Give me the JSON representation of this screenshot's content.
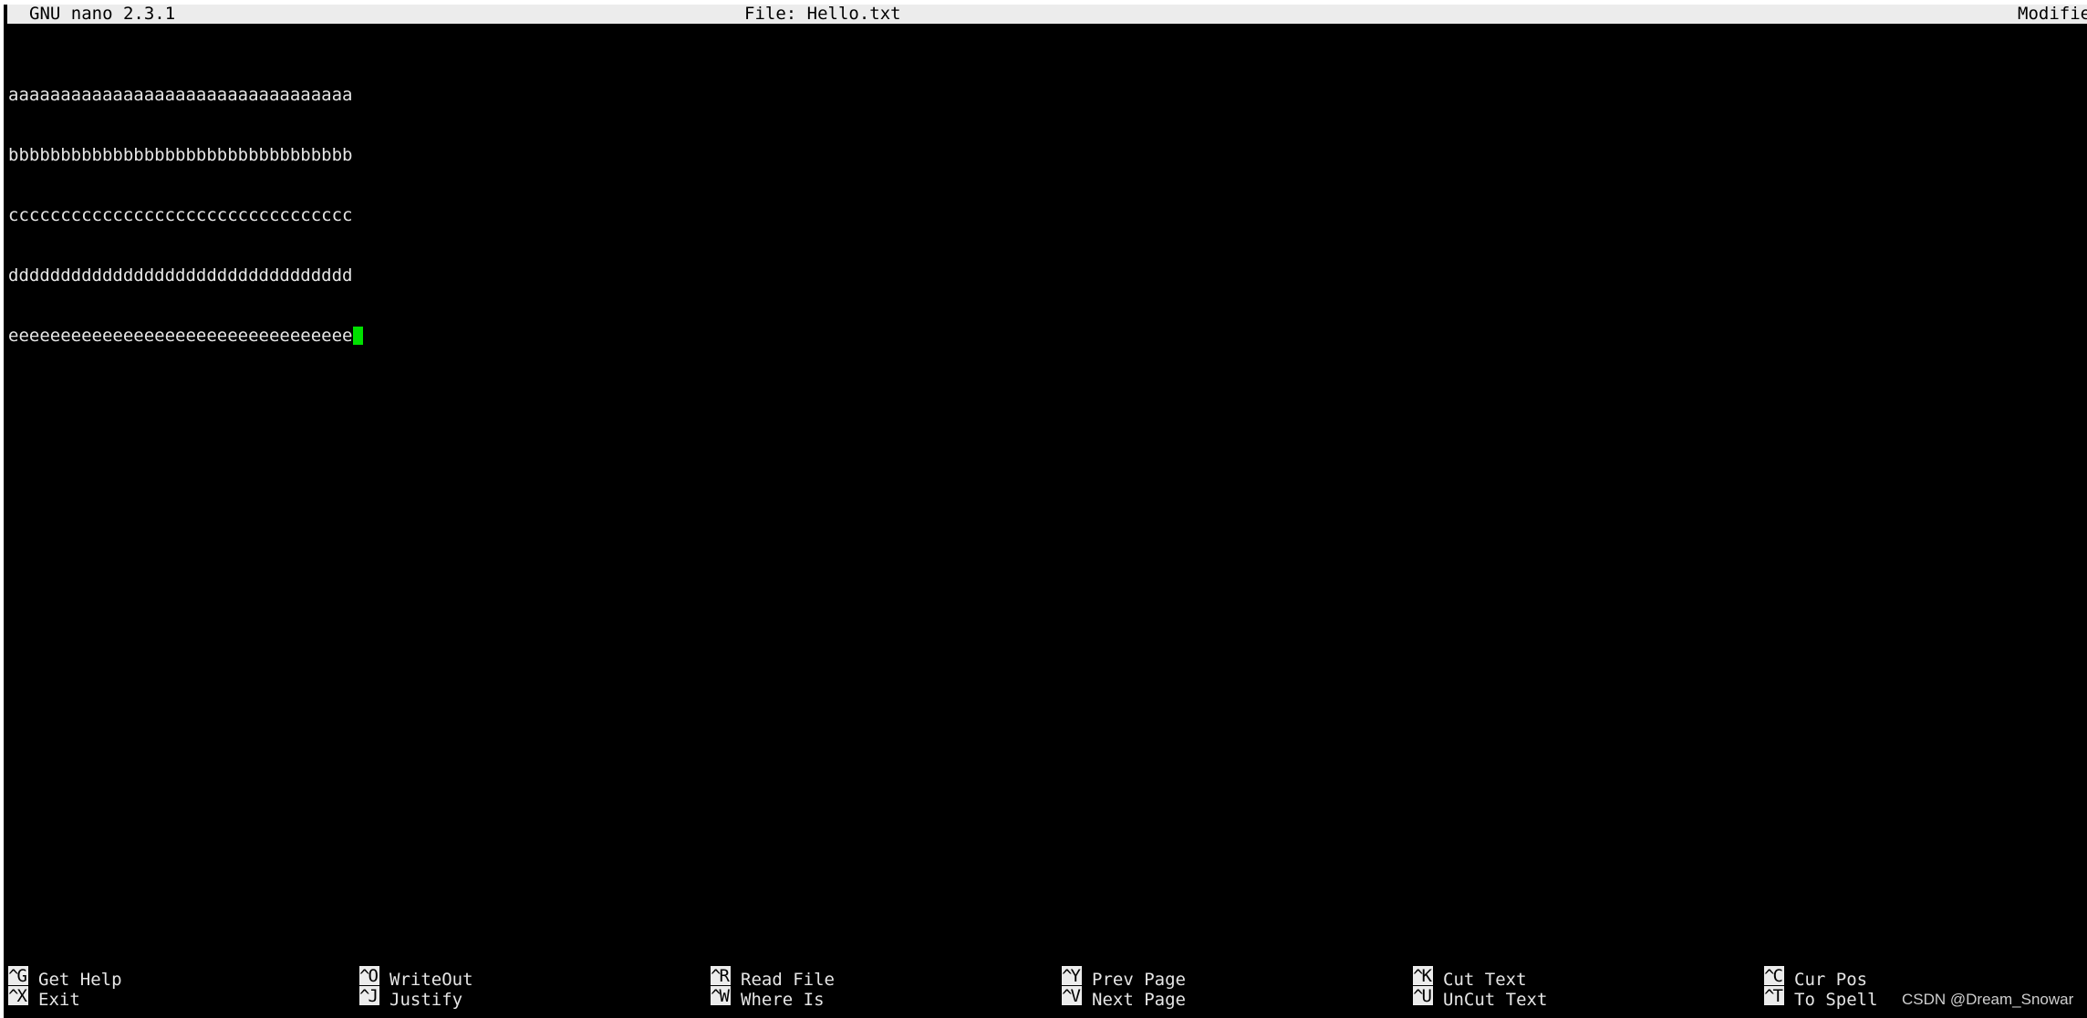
{
  "header": {
    "app_version": "GNU nano 2.3.1",
    "file_label": "File: Hello.txt",
    "status": "Modified"
  },
  "buffer": {
    "lines": [
      "aaaaaaaaaaaaaaaaaaaaaaaaaaaaaaaaa",
      "bbbbbbbbbbbbbbbbbbbbbbbbbbbbbbbbb",
      "ccccccccccccccccccccccccccccccccc",
      "ddddddddddddddddddddddddddddddddd",
      "eeeeeeeeeeeeeeeeeeeeeeeeeeeeeeeee"
    ]
  },
  "cursor_color": "#00e000",
  "shortcuts": [
    {
      "key": "^G",
      "label": "Get Help"
    },
    {
      "key": "^O",
      "label": "WriteOut"
    },
    {
      "key": "^R",
      "label": "Read File"
    },
    {
      "key": "^Y",
      "label": "Prev Page"
    },
    {
      "key": "^K",
      "label": "Cut Text"
    },
    {
      "key": "^C",
      "label": "Cur Pos"
    },
    {
      "key": "^X",
      "label": "Exit"
    },
    {
      "key": "^J",
      "label": "Justify"
    },
    {
      "key": "^W",
      "label": "Where Is"
    },
    {
      "key": "^V",
      "label": "Next Page"
    },
    {
      "key": "^U",
      "label": "UnCut Text"
    },
    {
      "key": "^T",
      "label": "To Spell"
    }
  ],
  "watermark": "CSDN @Dream_Snowar"
}
